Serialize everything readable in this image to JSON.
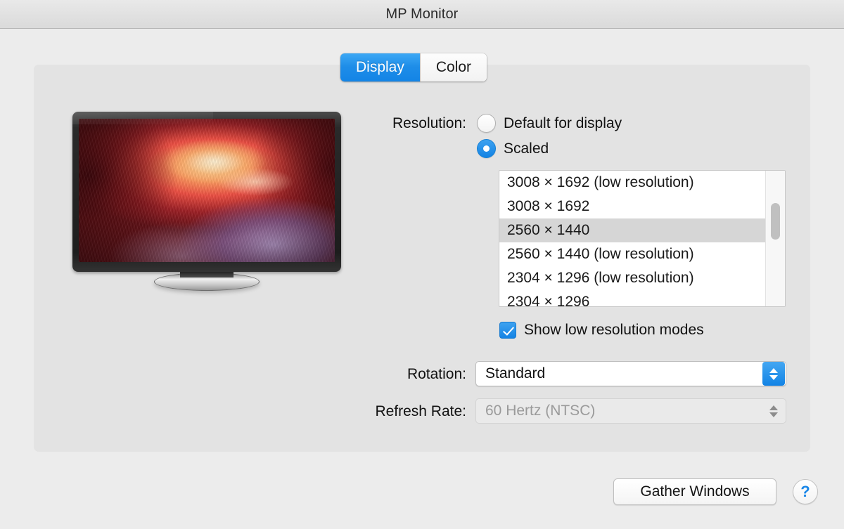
{
  "window": {
    "title": "MP Monitor"
  },
  "tabs": [
    {
      "label": "Display",
      "active": true
    },
    {
      "label": "Color",
      "active": false
    }
  ],
  "preview": {
    "device": "external-monitor",
    "wallpaper_description": "antelope-canyon"
  },
  "resolution": {
    "label": "Resolution:",
    "options": [
      {
        "label": "Default for display",
        "selected": false
      },
      {
        "label": "Scaled",
        "selected": true
      }
    ],
    "modes": [
      {
        "label": "3008 × 1692 (low resolution)",
        "selected": false
      },
      {
        "label": "3008 × 1692",
        "selected": false
      },
      {
        "label": "2560 × 1440",
        "selected": true
      },
      {
        "label": "2560 × 1440 (low resolution)",
        "selected": false
      },
      {
        "label": "2304 × 1296 (low resolution)",
        "selected": false
      },
      {
        "label": "2304 × 1296",
        "selected": false
      }
    ],
    "show_low_resolution": {
      "label": "Show low resolution modes",
      "checked": true
    }
  },
  "rotation": {
    "label": "Rotation:",
    "value": "Standard"
  },
  "refresh_rate": {
    "label": "Refresh Rate:",
    "value": "60 Hertz (NTSC)",
    "disabled": true
  },
  "footer": {
    "gather_windows_label": "Gather Windows",
    "help_label": "?"
  },
  "colors": {
    "accent_blue": "#1383e4",
    "window_background": "#ececec",
    "panel_background": "#e3e3e3",
    "selection_gray": "#d6d6d6",
    "disabled_text": "#9a9a9a"
  }
}
